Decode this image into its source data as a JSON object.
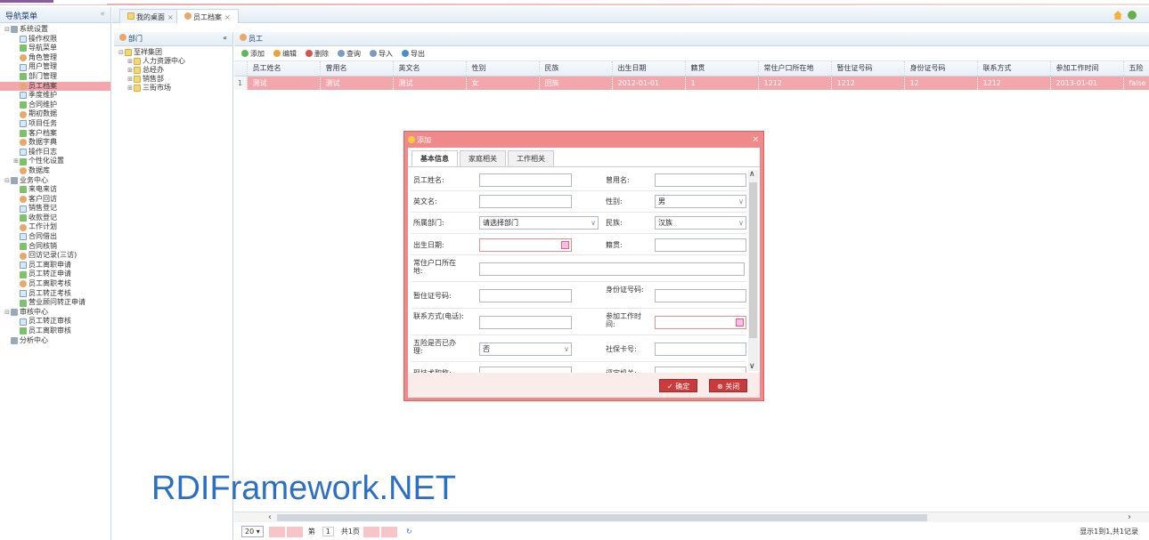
{
  "nav": {
    "title": "导航菜单",
    "items": [
      {
        "label": "系统设置",
        "level": 0,
        "toggle": "⊟"
      },
      {
        "label": "操作权限",
        "level": 1
      },
      {
        "label": "导航菜单",
        "level": 1
      },
      {
        "label": "角色管理",
        "level": 1
      },
      {
        "label": "用户管理",
        "level": 1
      },
      {
        "label": "部门管理",
        "level": 1
      },
      {
        "label": "员工档案",
        "level": 1,
        "selected": true
      },
      {
        "label": "季度维护",
        "level": 1
      },
      {
        "label": "合同维护",
        "level": 1
      },
      {
        "label": "期初数据",
        "level": 1
      },
      {
        "label": "项目任务",
        "level": 1
      },
      {
        "label": "客户档案",
        "level": 1
      },
      {
        "label": "数据字典",
        "level": 1
      },
      {
        "label": "操作日志",
        "level": 1
      },
      {
        "label": "个性化设置",
        "level": 1,
        "toggle": "⊞"
      },
      {
        "label": "数据库",
        "level": 1
      },
      {
        "label": "业务中心",
        "level": 0,
        "toggle": "⊟"
      },
      {
        "label": "来电来访",
        "level": 1
      },
      {
        "label": "客户回访",
        "level": 1
      },
      {
        "label": "销售登记",
        "level": 1
      },
      {
        "label": "收款登记",
        "level": 1
      },
      {
        "label": "工作计划",
        "level": 1
      },
      {
        "label": "合同借出",
        "level": 1
      },
      {
        "label": "合同核销",
        "level": 1
      },
      {
        "label": "回访记录(三访)",
        "level": 1
      },
      {
        "label": "员工离职申请",
        "level": 1
      },
      {
        "label": "员工转正申请",
        "level": 1
      },
      {
        "label": "员工离职考核",
        "level": 1
      },
      {
        "label": "员工转正考核",
        "level": 1
      },
      {
        "label": "营业顾问转正申请",
        "level": 1
      },
      {
        "label": "审核中心",
        "level": 0,
        "toggle": "⊟"
      },
      {
        "label": "员工转正审核",
        "level": 1
      },
      {
        "label": "员工离职审核",
        "level": 1
      },
      {
        "label": "分析中心",
        "level": 0
      }
    ]
  },
  "tabs": [
    {
      "label": "我的桌面"
    },
    {
      "label": "员工档案",
      "active": true
    }
  ],
  "dept": {
    "title": "部门",
    "root": "至祥集团",
    "children": [
      "人力资源中心",
      "总经办",
      "销售部",
      "三街市场"
    ]
  },
  "employee": {
    "title": "员工",
    "toolbar": [
      "添加",
      "编辑",
      "删除",
      "查询",
      "导入",
      "导出"
    ],
    "columns": [
      "员工姓名",
      "曾用名",
      "英文名",
      "性别",
      "民族",
      "出生日期",
      "籍贯",
      "常住户口所在地",
      "暂住证号码",
      "身份证号码",
      "联系方式",
      "参加工作时间",
      "五险"
    ],
    "rows": [
      {
        "no": "1",
        "cells": [
          "测试",
          "测试",
          "测试",
          "女",
          "回族",
          "2012-01-01",
          "1",
          "1212",
          "1212",
          "12",
          "1212",
          "2013-01-01",
          "false"
        ]
      }
    ]
  },
  "pager": {
    "page_size": "20",
    "page_prefix": "第",
    "page_current": "1",
    "page_total": "共1页",
    "info": "显示1到1,共1记录"
  },
  "watermark": "RDIFramework.NET",
  "dialog": {
    "title": "添加",
    "tabs": [
      "基本信息",
      "家庭相关",
      "工作相关"
    ],
    "fields": {
      "name": "员工姓名:",
      "former_name": "曾用名:",
      "english_name": "英文名:",
      "gender": "性别:",
      "gender_value": "男",
      "dept": "所属部门:",
      "dept_value": "请选择部门",
      "nation": "民族:",
      "nation_value": "汉族",
      "birthday": "出生日期:",
      "native_place": "籍贯:",
      "residence": "常住户口所在地:",
      "temp_permit": "暂住证号码:",
      "id_card": "身份证号码:",
      "contact": "联系方式(电话):",
      "work_start": "参加工作时间:",
      "insurance": "五险是否已办理:",
      "insurance_value": "否",
      "social_card": "社保卡号:",
      "tech_title": "现技术职称:",
      "eval_org": "评定机关:"
    },
    "ok": "确定",
    "close": "关闭"
  }
}
